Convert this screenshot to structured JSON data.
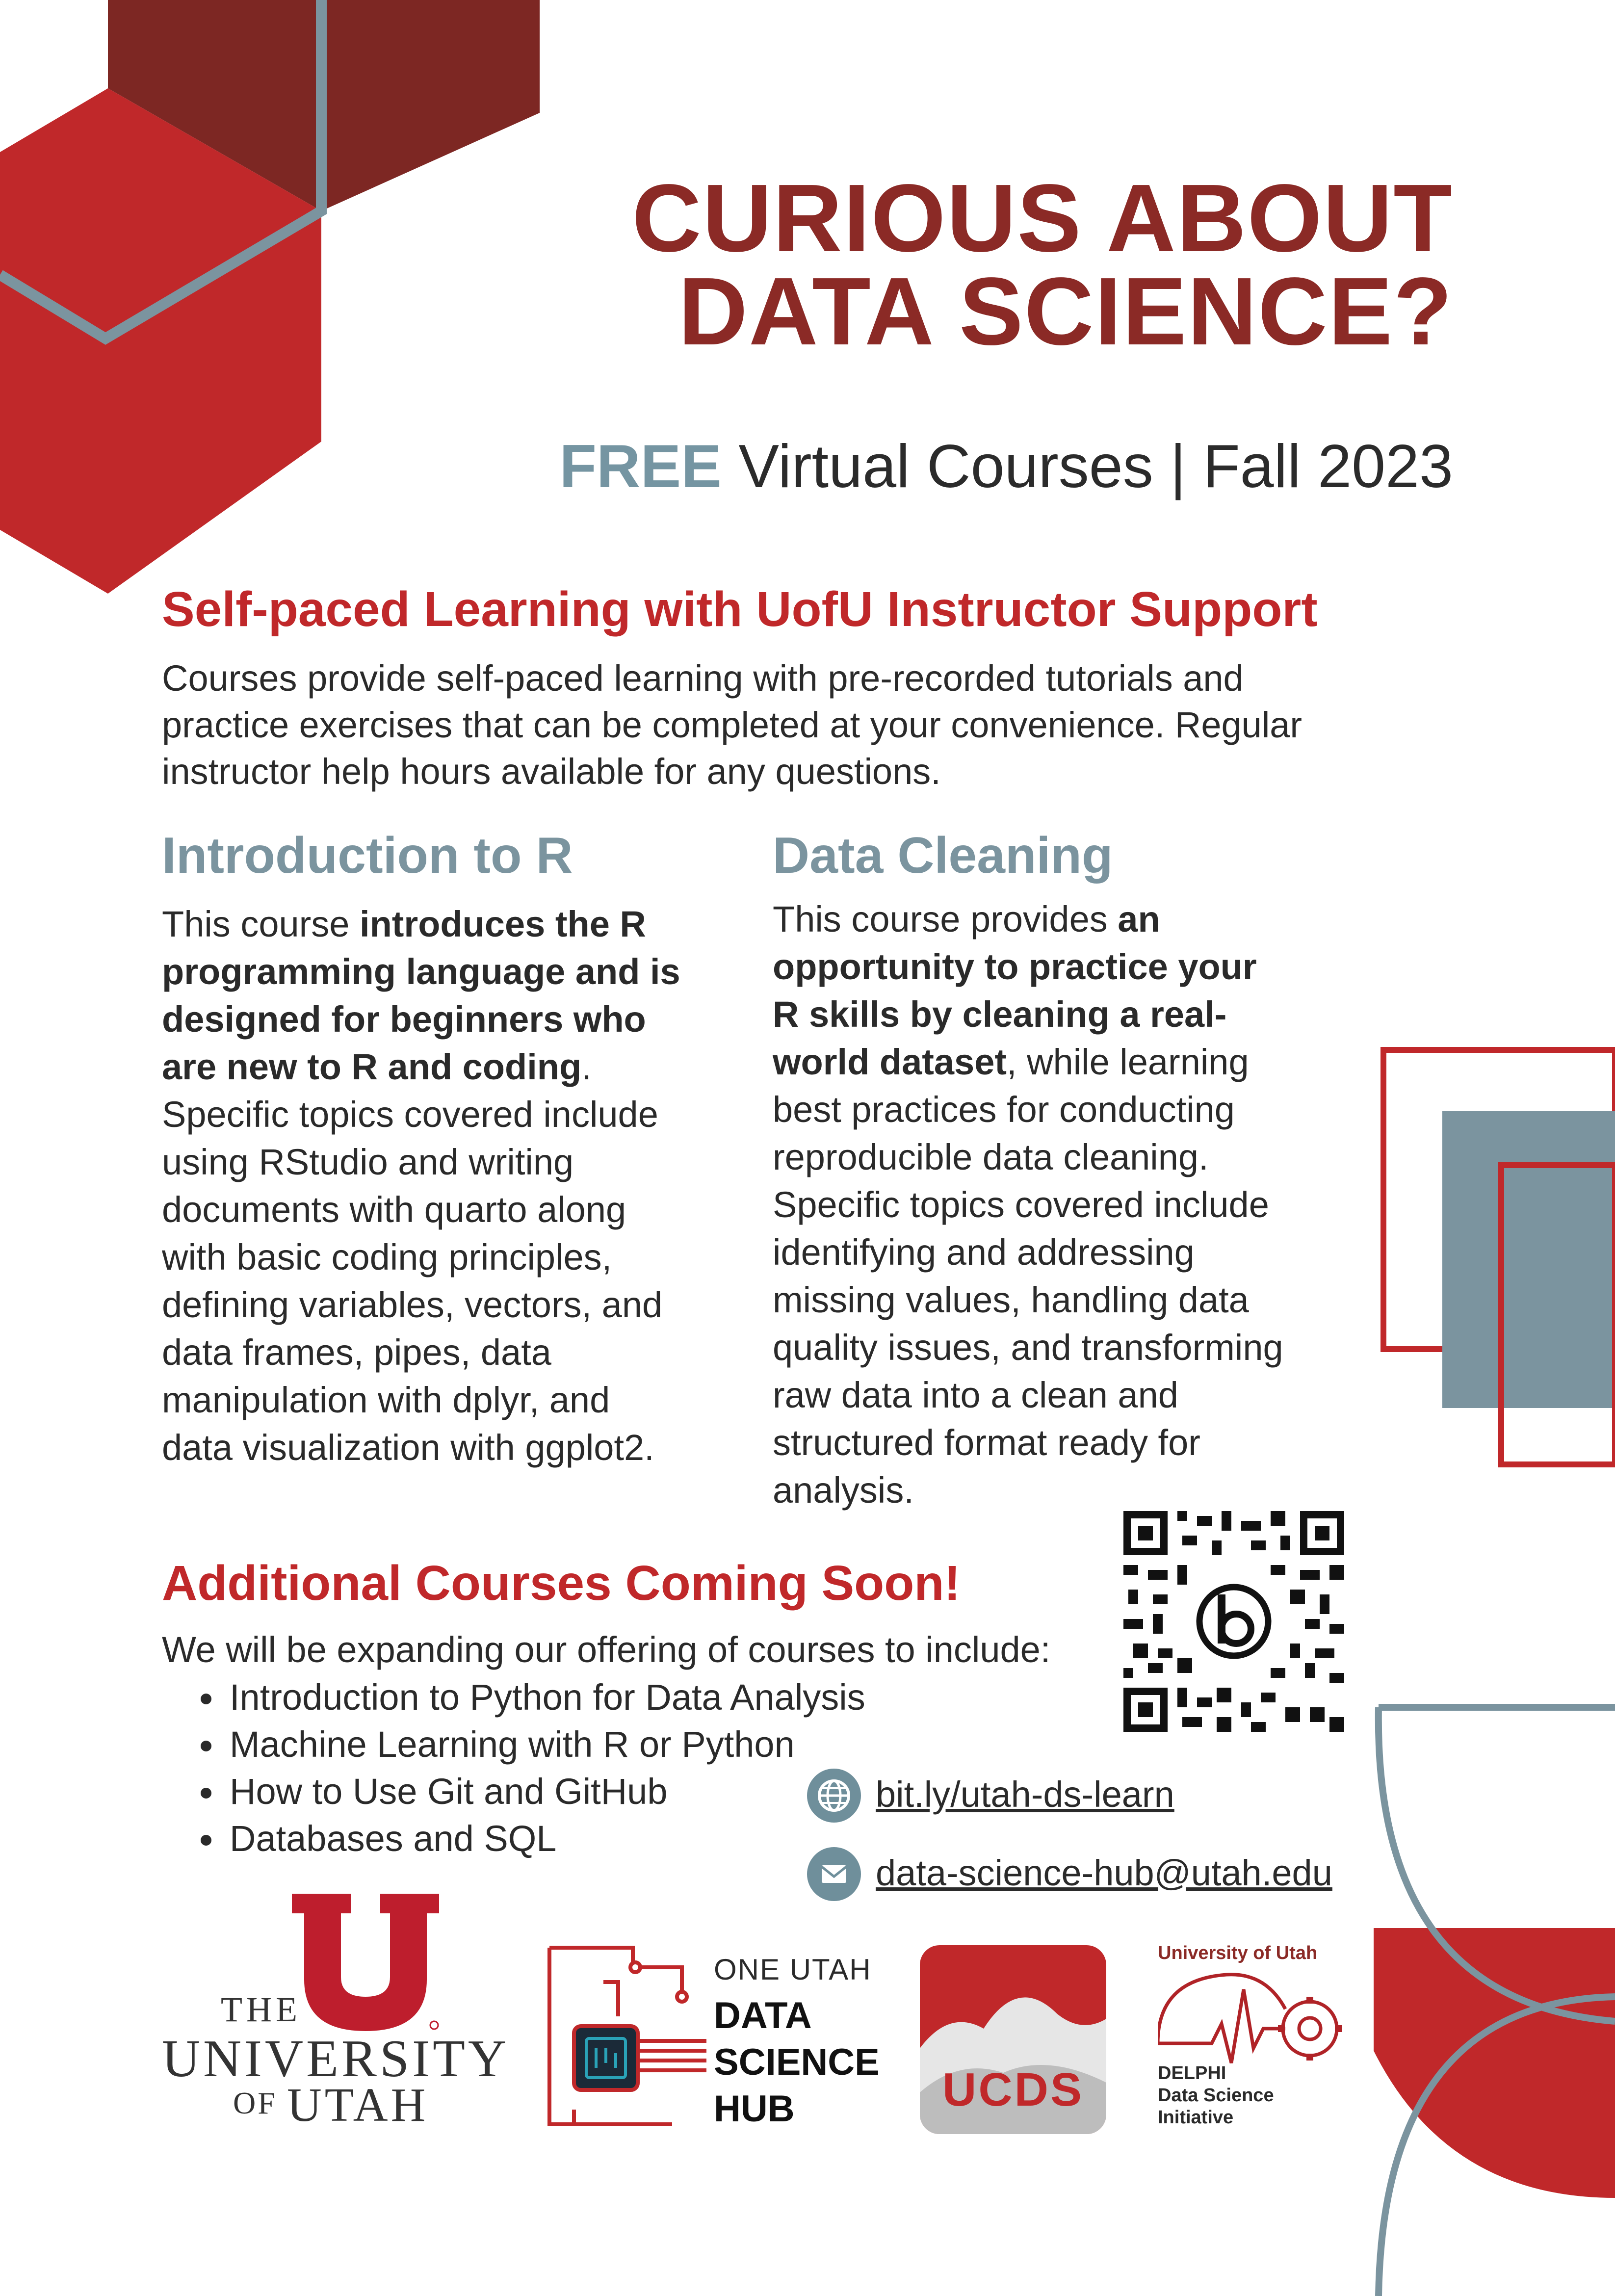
{
  "colors": {
    "dark_red": "#8b2a26",
    "red": "#c0282a",
    "slate": "#7b949f",
    "text": "#2a2a2a"
  },
  "hero": {
    "title_line1": "CURIOUS ABOUT",
    "title_line2": "DATA SCIENCE?",
    "subtitle_free": "FREE",
    "subtitle_rest": " Virtual Courses |  Fall 2023"
  },
  "intro": {
    "heading": "Self-paced Learning with UofU Instructor Support",
    "line1": "Courses provide self-paced learning with pre-recorded tutorials and",
    "line2": "practice exercises that can be completed at your convenience. Regular",
    "line3": "instructor help hours available for any questions."
  },
  "course_r": {
    "heading": "Introduction to R",
    "lead": "This course ",
    "bold": "introduces the R programming language and is designed for beginners who are new to R and coding",
    "rest": ". Specific topics covered include using RStudio and writing documents with quarto along with basic coding principles, defining variables, vectors, and data frames, pipes, data manipulation with dplyr, and data visualization with ggplot2."
  },
  "course_cleaning": {
    "heading": "Data Cleaning",
    "lead": "This course provides ",
    "bold": "an opportunity to practice your R skills by cleaning a real-world  dataset",
    "rest": ", while learning best practices for conducting reproducible data cleaning. Specific topics covered include identifying and addressing missing values, handling data quality issues, and transforming raw data into a clean and structured format ready for analysis."
  },
  "additional": {
    "heading": "Additional Courses Coming Soon!",
    "intro": "We will be expanding our offering of courses to include:",
    "items": [
      "Introduction to Python for Data Analysis",
      "Machine Learning with R or Python",
      "How to Use Git and GitHub",
      "Databases and SQL"
    ]
  },
  "contact": {
    "web_icon": "globe-icon",
    "web_link": "bit.ly/utah-ds-learn",
    "email_icon": "envelope-icon",
    "email_link": "data-science-hub@utah.edu"
  },
  "logos": {
    "uofu_the": "THE",
    "uofu_university": "UNIVERSITY",
    "uofu_of": "OF",
    "uofu_utah": "UTAH",
    "hub_line1": "ONE UTAH",
    "hub_line2": "DATA",
    "hub_line3": "SCIENCE",
    "hub_line4": "HUB",
    "ucds": "UCDS",
    "delphi_top": "University of Utah",
    "delphi_line1": "DELPHI",
    "delphi_line2": "Data Science",
    "delphi_line3": "Initiative"
  }
}
